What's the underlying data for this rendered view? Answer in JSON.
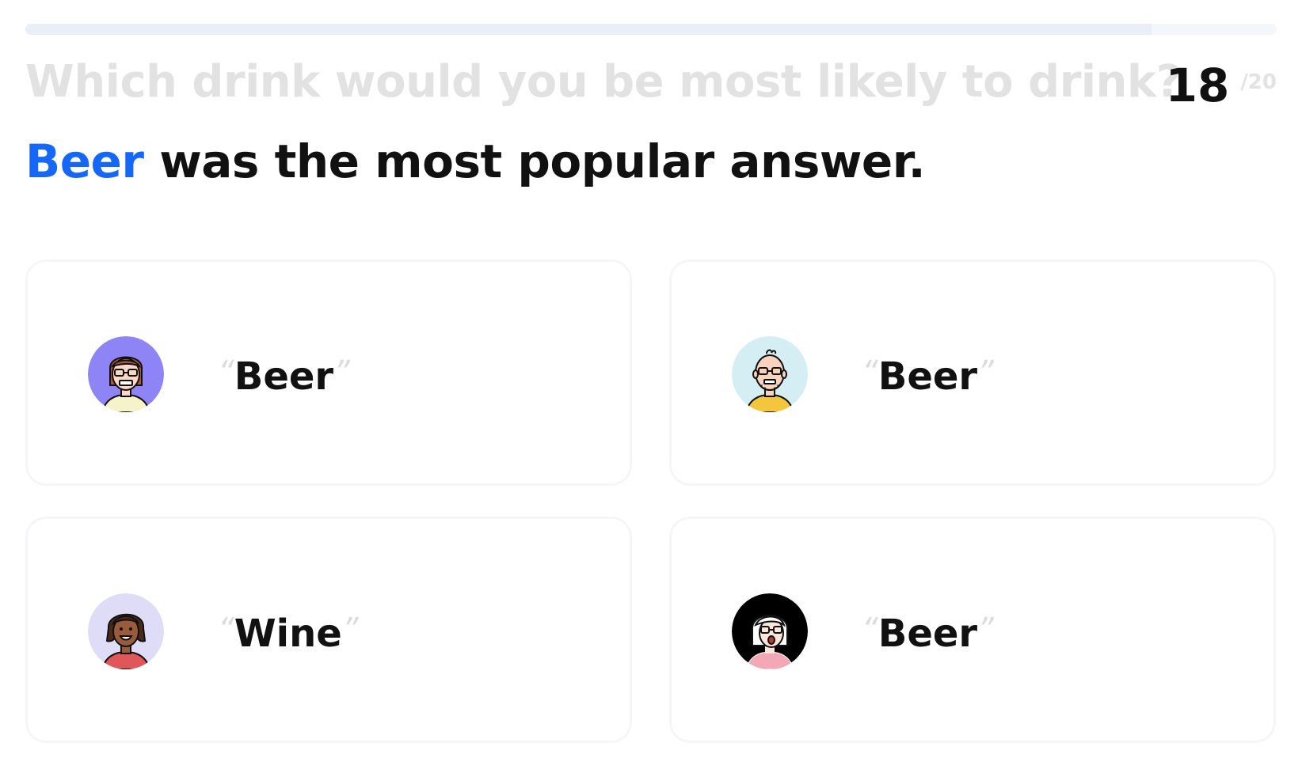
{
  "progress": {
    "current": 18,
    "total": 20
  },
  "question": {
    "text": "Which drink would you be most likely to drink?",
    "counter_current": "18",
    "counter_total": "/20"
  },
  "result": {
    "highlight": "Beer",
    "rest": " was the most popular answer."
  },
  "quote_open": "“",
  "quote_close": "”",
  "answers": [
    {
      "text": "Beer",
      "avatar": "avatar-purple-woman-glasses-icon",
      "avatar_bg": "#8f84f5"
    },
    {
      "text": "Beer",
      "avatar": "avatar-bald-man-glasses-icon",
      "avatar_bg": "#d4eef3"
    },
    {
      "text": "Wine",
      "avatar": "avatar-smiling-woman-icon",
      "avatar_bg": "#dedcf7"
    },
    {
      "text": "Beer",
      "avatar": "avatar-black-bg-person-glasses-icon",
      "avatar_bg": "#000000"
    }
  ],
  "colors": {
    "accent": "#1568f5",
    "question_text": "#e2e2e2",
    "primary_text": "#111111",
    "card_border": "#f4f6fa"
  }
}
